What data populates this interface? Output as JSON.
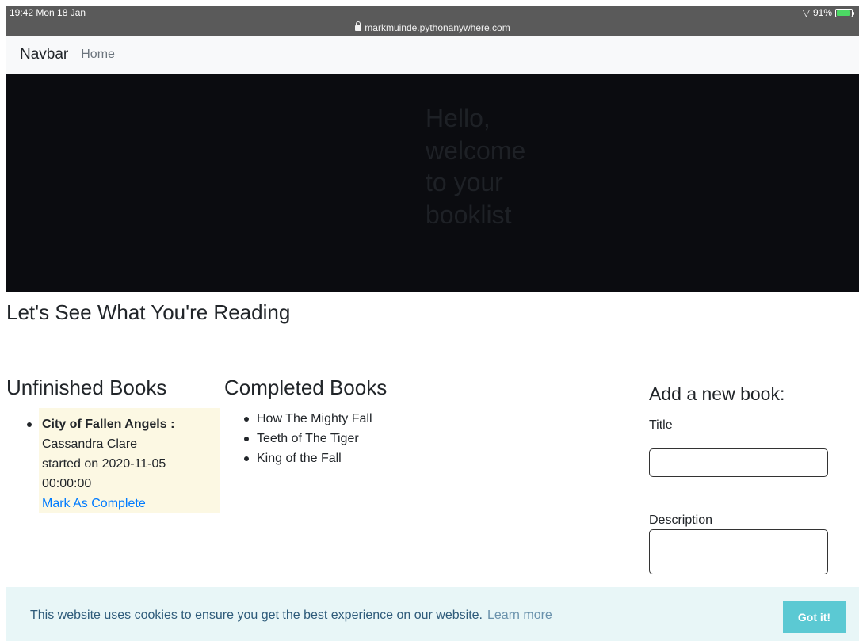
{
  "status_bar": {
    "time": "19:42  Mon 18 Jan",
    "url": "markmuinde.pythonanywhere.com",
    "battery": "91%",
    "battery_level": 0.91
  },
  "navbar": {
    "brand": "Navbar",
    "links": [
      "Home"
    ]
  },
  "hero": {
    "message": "Hello, welcome to your booklist"
  },
  "main": {
    "heading": "Let's See What You're Reading",
    "unfinished": {
      "title": "Unfinished Books",
      "items": [
        {
          "title": "City of Fallen Angels :",
          "author": "Cassandra Clare",
          "started": "started on 2020-11-05 00:00:00",
          "action": "Mark As Complete"
        }
      ]
    },
    "completed": {
      "title": "Completed Books",
      "items": [
        "How The Mighty Fall",
        "Teeth of The Tiger",
        "King of the Fall"
      ]
    },
    "form": {
      "title": "Add a new book:",
      "title_label": "Title",
      "description_label": "Description"
    }
  },
  "cookie_banner": {
    "message": "This website uses cookies to ensure you get the best experience on our website.",
    "learn_more": "Learn more",
    "accept": "Got it!"
  },
  "colors": {
    "navbar_bg": "#f8f9fa",
    "hero_bg": "#0b0c10",
    "hero_text": "#1e2126",
    "highlight_bg": "#fcf8e3",
    "link": "#007bff",
    "cookie_bg": "#e8f6f7",
    "cookie_button": "#5bc9d3"
  }
}
